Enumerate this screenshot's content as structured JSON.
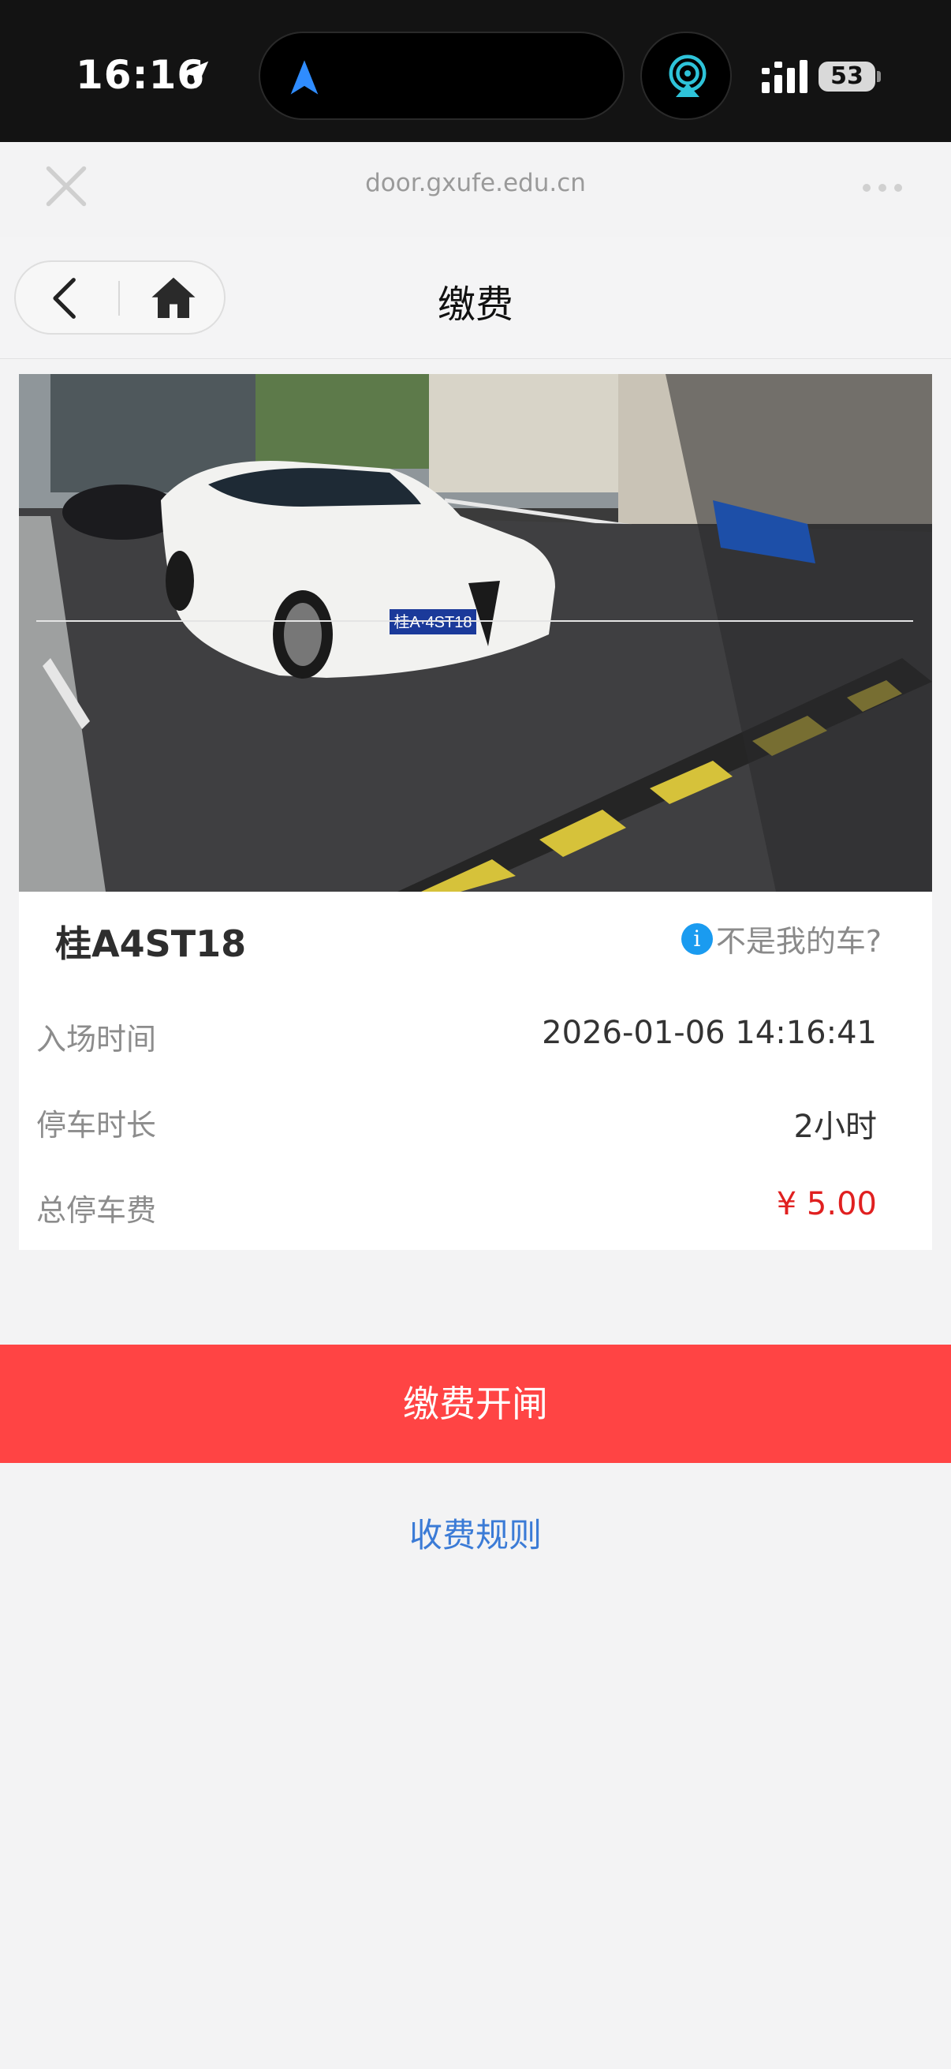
{
  "status_bar": {
    "time": "16:16",
    "battery": "53",
    "icons": [
      "location-arrow-icon",
      "navigation-icon",
      "airplay-cast-icon",
      "cellular-signal-icon",
      "battery-icon"
    ]
  },
  "browser": {
    "url": "door.gxufe.edu.cn",
    "icons": [
      "close-icon",
      "more-icon"
    ]
  },
  "header": {
    "title": "缴费",
    "icons": [
      "back-chevron-icon",
      "home-icon"
    ]
  },
  "vehicle": {
    "plate": "桂A4ST18",
    "not_mine_label": "不是我的车?",
    "info_icon": "info-icon"
  },
  "details": [
    {
      "label": "入场时间",
      "value": "2026-01-06 14:16:41"
    },
    {
      "label": "停车时长",
      "value": "2小时"
    },
    {
      "label": "总停车费",
      "value": "¥ 5.00"
    }
  ],
  "colors": {
    "pay_button": "#ff4444",
    "fee_text": "#e02020",
    "link": "#3b7bd6",
    "info_icon": "#1a9bf0"
  },
  "actions": {
    "pay_button_label": "缴费开闸",
    "rules_link_label": "收费规则"
  }
}
